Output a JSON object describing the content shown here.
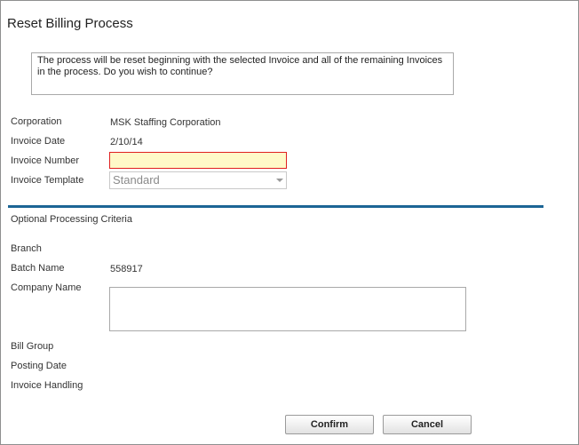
{
  "dialog": {
    "title": "Reset Billing Process",
    "message": "The process will be reset beginning with the selected Invoice and all of the remaining Invoices in the process. Do you wish to continue?"
  },
  "fields": {
    "corporation_label": "Corporation",
    "corporation_value": "MSK Staffing Corporation",
    "invoice_date_label": "Invoice Date",
    "invoice_date_value": "2/10/14",
    "invoice_number_label": "Invoice Number",
    "invoice_number_value": "",
    "invoice_template_label": "Invoice Template",
    "invoice_template_value": "Standard"
  },
  "optional": {
    "section_title": "Optional Processing Criteria",
    "branch_label": "Branch",
    "batch_name_label": "Batch Name",
    "batch_name_value": "558917",
    "company_name_label": "Company Name",
    "company_name_value": "",
    "bill_group_label": "Bill Group",
    "posting_date_label": "Posting Date",
    "invoice_handling_label": "Invoice Handling"
  },
  "buttons": {
    "confirm_label": "Confirm",
    "cancel_label": "Cancel"
  },
  "colors": {
    "divider": "#1c6595",
    "required_border": "#e02020",
    "required_fill": "#fff9c8"
  },
  "icons": {
    "select_arrow": "chevron-down-icon"
  }
}
